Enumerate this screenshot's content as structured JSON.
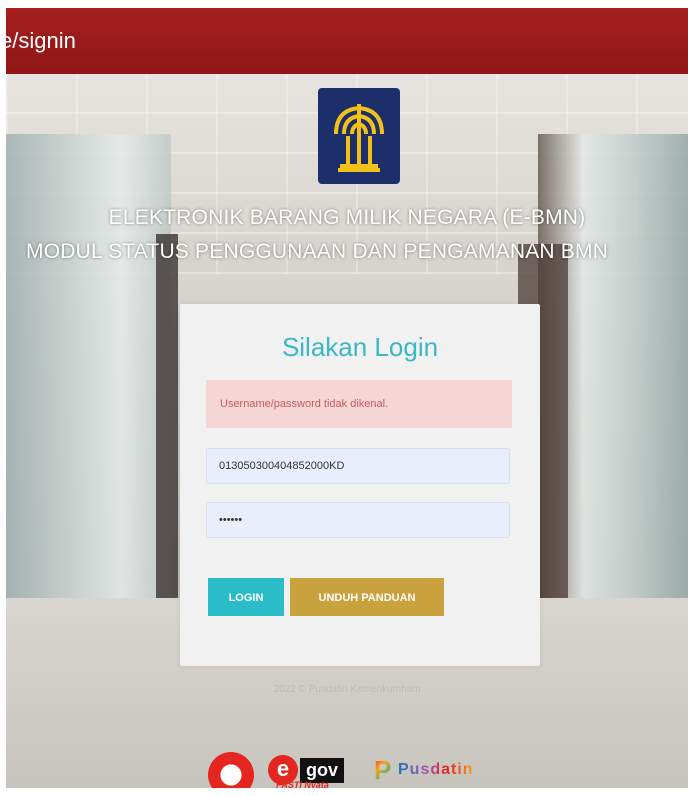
{
  "browser": {
    "url_fragment": "e/signin"
  },
  "hero": {
    "logo_icon": "kemenkumham-tree-emblem-icon",
    "title_line1": "ELEKTRONIK BARANG MILIK NEGARA (E-BMN)",
    "title_line2": "MODUL STATUS PENGGUNAAN DAN PENGAMANAN BMN"
  },
  "login": {
    "heading": "Silakan Login",
    "error_message": "Username/password tidak dikenal.",
    "username_value": "013050300404852000KD",
    "password_value": "••••••",
    "login_label": "LOGIN",
    "guide_label": "UNDUH PANDUAN"
  },
  "footer": {
    "copyright": "2022 © Pusdatin Kemenkumham",
    "egov_e": "e",
    "egov_label": "gov",
    "egov_sub": "PASTI Nyata",
    "pusdatin_label": "Pusdatin"
  },
  "colors": {
    "topbar": "#a51f1f",
    "accent_teal": "#2bbcc9",
    "accent_gold": "#c9a23d",
    "error_bg": "#f6d5d5"
  }
}
